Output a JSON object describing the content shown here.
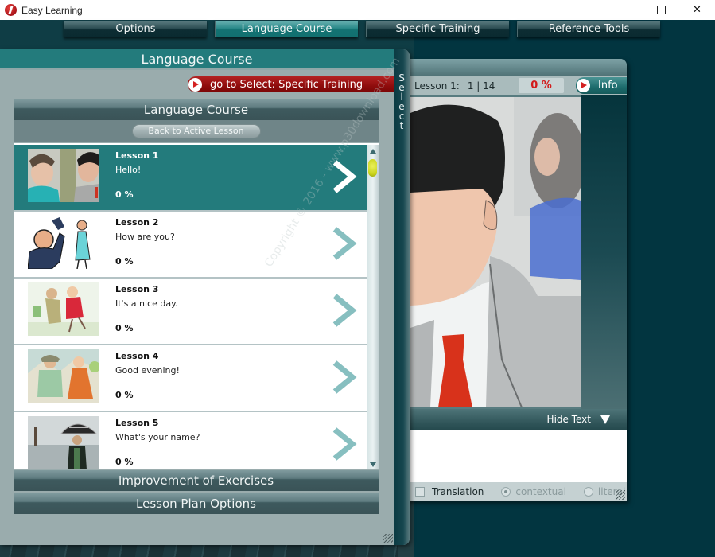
{
  "window": {
    "title": "Easy Learning",
    "controls": {
      "minimize": "minimize",
      "maximize": "maximize",
      "close": "✕"
    }
  },
  "topnav": {
    "tabs": [
      {
        "label": "Options",
        "active": false
      },
      {
        "label": "Language Course",
        "active": true
      },
      {
        "label": "Specific Training",
        "active": false
      },
      {
        "label": "Reference Tools",
        "active": false
      }
    ]
  },
  "left_panel": {
    "title": "Language Course",
    "goto_button": "go to Select: Specific Training",
    "side_tab_letters": [
      "S",
      "e",
      "l",
      "e",
      "c",
      "t"
    ],
    "course": {
      "title": "Language Course",
      "back_button": "Back to Active Lesson",
      "lessons": [
        {
          "name": "Lesson 1",
          "subtitle": "Hello!",
          "progress": "0 %",
          "active": true
        },
        {
          "name": "Lesson 2",
          "subtitle": "How are you?",
          "progress": "0 %",
          "active": false
        },
        {
          "name": "Lesson 3",
          "subtitle": "It's a nice day.",
          "progress": "0 %",
          "active": false
        },
        {
          "name": "Lesson 4",
          "subtitle": "Good evening!",
          "progress": "0 %",
          "active": false
        },
        {
          "name": "Lesson 5",
          "subtitle": "What's your name?",
          "progress": "0 %",
          "active": false
        }
      ]
    },
    "sections": [
      {
        "label": "Improvement of Exercises"
      },
      {
        "label": "Lesson Plan Options"
      }
    ]
  },
  "lesson_window": {
    "lesson_label": "Lesson 1:",
    "page_current": "1",
    "page_total": "14",
    "page_indicator": "1 | 14",
    "progress": "0 %",
    "info_button": "Info",
    "hide_text": "Hide Text",
    "translation_label": "Translation",
    "translation_checked": false,
    "mode_options": [
      {
        "label": "contextual",
        "selected": true
      },
      {
        "label": "literal",
        "selected": false
      }
    ]
  },
  "watermark": "Copyright © 2016 - www.p30download.com",
  "colors": {
    "background": "#023540",
    "teal_accent": "#237b7c",
    "goto_red": "#8e0c0c",
    "progress_red": "#d21c1c",
    "panel_gray": "#9aacad"
  }
}
